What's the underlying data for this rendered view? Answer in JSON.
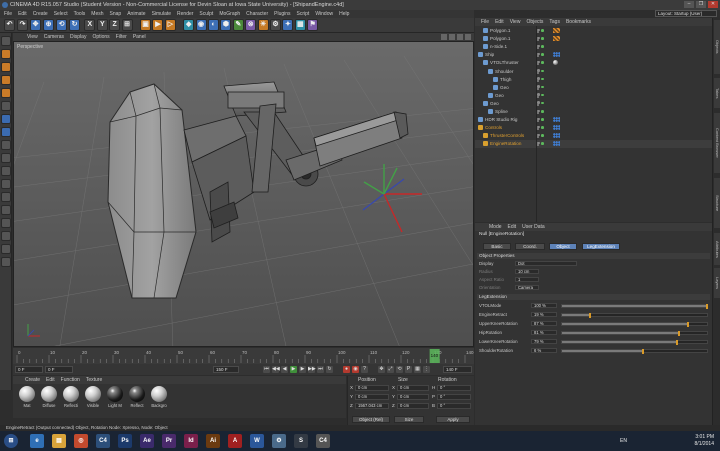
{
  "window": {
    "title": "CINEMA 4D R15.057 Studio (Student Version - Non-Commercial License for Devin Sloan at Iowa State University) - [ShipandEngine.c4d]",
    "controls": [
      "–",
      "❐",
      "✕"
    ]
  },
  "menubar": {
    "items": [
      "File",
      "Edit",
      "Create",
      "Select",
      "Tools",
      "Mesh",
      "Snap",
      "Animate",
      "Simulate",
      "Render",
      "Sculpt",
      "MoGraph",
      "Character",
      "Plugins",
      "Script",
      "Window",
      "Help"
    ],
    "layout_label": "Layout:",
    "layout_value": "Startup (User)"
  },
  "toolbar": {
    "buttons": [
      "↶",
      "↷",
      "✥",
      "⊕",
      "⟲",
      "↻",
      "X",
      "Y",
      "Z",
      "⊞",
      "▣",
      "▶",
      "▷",
      "◆",
      "◉",
      "◐",
      "⬢",
      "✎",
      "⊗",
      "☀",
      "⚙",
      "✦",
      "▦",
      "⚑"
    ]
  },
  "viewport": {
    "menu": [
      "View",
      "Cameras",
      "Display",
      "Options",
      "Filter",
      "Panel"
    ],
    "label": "Perspective"
  },
  "timeline": {
    "ticks": [
      "0",
      "10",
      "20",
      "30",
      "40",
      "50",
      "60",
      "70",
      "80",
      "90",
      "100",
      "110",
      "120",
      "130",
      "140"
    ],
    "current_frame": "140",
    "frame_start": "0 F",
    "frame_current_field": "0 F",
    "frame_end": "150 F",
    "frame_max": "140 F",
    "playhead_fraction": 0.93
  },
  "material_manager": {
    "menu": [
      "Create",
      "Edit",
      "Function",
      "Texture"
    ],
    "materials": [
      {
        "name": "Mat",
        "dark": false
      },
      {
        "name": "Diffuse",
        "dark": false
      },
      {
        "name": "Reflecti",
        "dark": false
      },
      {
        "name": "Visible",
        "dark": false
      },
      {
        "name": "Light M",
        "dark": true
      },
      {
        "name": "Reflect",
        "dark": true
      },
      {
        "name": "Backgro",
        "dark": false
      }
    ]
  },
  "coordinates": {
    "headers": [
      "Position",
      "Size",
      "Rotation"
    ],
    "rows": [
      {
        "axis": "X",
        "pos": "0 cm",
        "size_axis": "X",
        "size": "0 cm",
        "rot_axis": "H",
        "rot": "0 °"
      },
      {
        "axis": "Y",
        "pos": "0 cm",
        "size_axis": "Y",
        "size": "0 cm",
        "rot_axis": "P",
        "rot": "0 °"
      },
      {
        "axis": "Z",
        "pos": "1567.043 cm",
        "size_axis": "Z",
        "size": "0 cm",
        "rot_axis": "B",
        "rot": "0 °"
      }
    ],
    "mode_dropdown": "Object (Rel)",
    "size_dropdown": "Size",
    "apply_label": "Apply"
  },
  "status_bar": {
    "text": "EngineRetract (Output connected) Object, Rotation Node: Xpresso, Node: Object"
  },
  "object_manager": {
    "menu": [
      "File",
      "Edit",
      "View",
      "Objects",
      "Tags",
      "Bookmarks"
    ],
    "rows": [
      {
        "indent": 1,
        "name": "Polygon.1",
        "color": "#c8c8c8",
        "tag": "checker"
      },
      {
        "indent": 1,
        "name": "Polygon.1",
        "color": "#c8c8c8",
        "tag": "checker"
      },
      {
        "indent": 1,
        "name": "n-Side.1",
        "color": "#c8c8c8",
        "tag": ""
      },
      {
        "indent": 0,
        "name": "Ship",
        "color": "#c8c8c8",
        "tag": "dots"
      },
      {
        "indent": 1,
        "name": "VTOLThruster",
        "color": "#c8c8c8",
        "tag": "sphere"
      },
      {
        "indent": 2,
        "name": "Shoulder",
        "color": "#c8c8c8",
        "tag": ""
      },
      {
        "indent": 3,
        "name": "Thigh",
        "color": "#c8c8c8",
        "tag": ""
      },
      {
        "indent": 3,
        "name": "Geo",
        "color": "#c8c8c8",
        "tag": ""
      },
      {
        "indent": 2,
        "name": "Geo",
        "color": "#c8c8c8",
        "tag": ""
      },
      {
        "indent": 1,
        "name": "Geo",
        "color": "#c8c8c8",
        "tag": ""
      },
      {
        "indent": 2,
        "name": "Spline",
        "color": "#c8c8c8",
        "tag": ""
      },
      {
        "indent": 0,
        "name": "HDR Studio Rig",
        "color": "#c8c8c8",
        "tag": "dots"
      },
      {
        "indent": 0,
        "name": "Controls",
        "color": "#e0a030",
        "tag": "dots"
      },
      {
        "indent": 1,
        "name": "ThrusterControls",
        "color": "#e0a030",
        "tag": "dots"
      },
      {
        "indent": 1,
        "name": "EngineRotation",
        "color": "#e0a030",
        "tag": "dots",
        "selected": true
      }
    ]
  },
  "attribute_manager": {
    "menu": [
      "Mode",
      "Edit",
      "User Data"
    ],
    "title": "Null [EngineRotation]",
    "tabs": [
      "Basic",
      "Coord.",
      "Object",
      "LegExtension"
    ],
    "active_tab": "Object",
    "section_object": "Object Properties",
    "props": [
      {
        "label": "Display",
        "value": "Dot",
        "dim": false
      },
      {
        "label": "Radius",
        "value": "10 cm",
        "dim": true
      },
      {
        "label": "Aspect Ratio",
        "value": "1",
        "dim": true
      },
      {
        "label": "Orientation",
        "value": "Camera",
        "dim": true
      }
    ],
    "section_leg": "LegExtension",
    "sliders": [
      {
        "label": "VTOLMode",
        "value": "100 %",
        "fraction": 1.0
      },
      {
        "label": "EngineRetract",
        "value": "19 %",
        "fraction": 0.19
      },
      {
        "label": "UpperKneeRotation",
        "value": "87 %",
        "fraction": 0.87
      },
      {
        "label": "HipRotation",
        "value": "81 %",
        "fraction": 0.81
      },
      {
        "label": "LowerKneeRotation",
        "value": "79 %",
        "fraction": 0.79
      },
      {
        "label": "ShoulderRotation",
        "value": "6 %",
        "fraction": 0.56
      }
    ]
  },
  "edge_tabs": [
    "Objects",
    "Takes",
    "Content Browser",
    "Structure",
    "Attributes",
    "Layers"
  ],
  "taskbar": {
    "apps": [
      {
        "label": "⊞",
        "color": "#2a4e86"
      },
      {
        "label": "e",
        "color": "#2f6fb5"
      },
      {
        "label": "▤",
        "color": "#d8a33a"
      },
      {
        "label": "◎",
        "color": "#c24a2e"
      },
      {
        "label": "C4",
        "color": "#2c4f7a"
      },
      {
        "label": "Ps",
        "color": "#1c3a6b"
      },
      {
        "label": "Ae",
        "color": "#3a2a6b"
      },
      {
        "label": "Pr",
        "color": "#4a2a6b"
      },
      {
        "label": "Id",
        "color": "#7a1f4b"
      },
      {
        "label": "Ai",
        "color": "#6b3a10"
      },
      {
        "label": "A",
        "color": "#a02020"
      },
      {
        "label": "W",
        "color": "#2b579a"
      },
      {
        "label": "⚙",
        "color": "#4a6a8a"
      },
      {
        "label": "S",
        "color": "#333a44"
      },
      {
        "label": "C4",
        "color": "#555555"
      }
    ],
    "lang": "EN",
    "time": "3:01 PM",
    "date": "8/1/2014"
  }
}
